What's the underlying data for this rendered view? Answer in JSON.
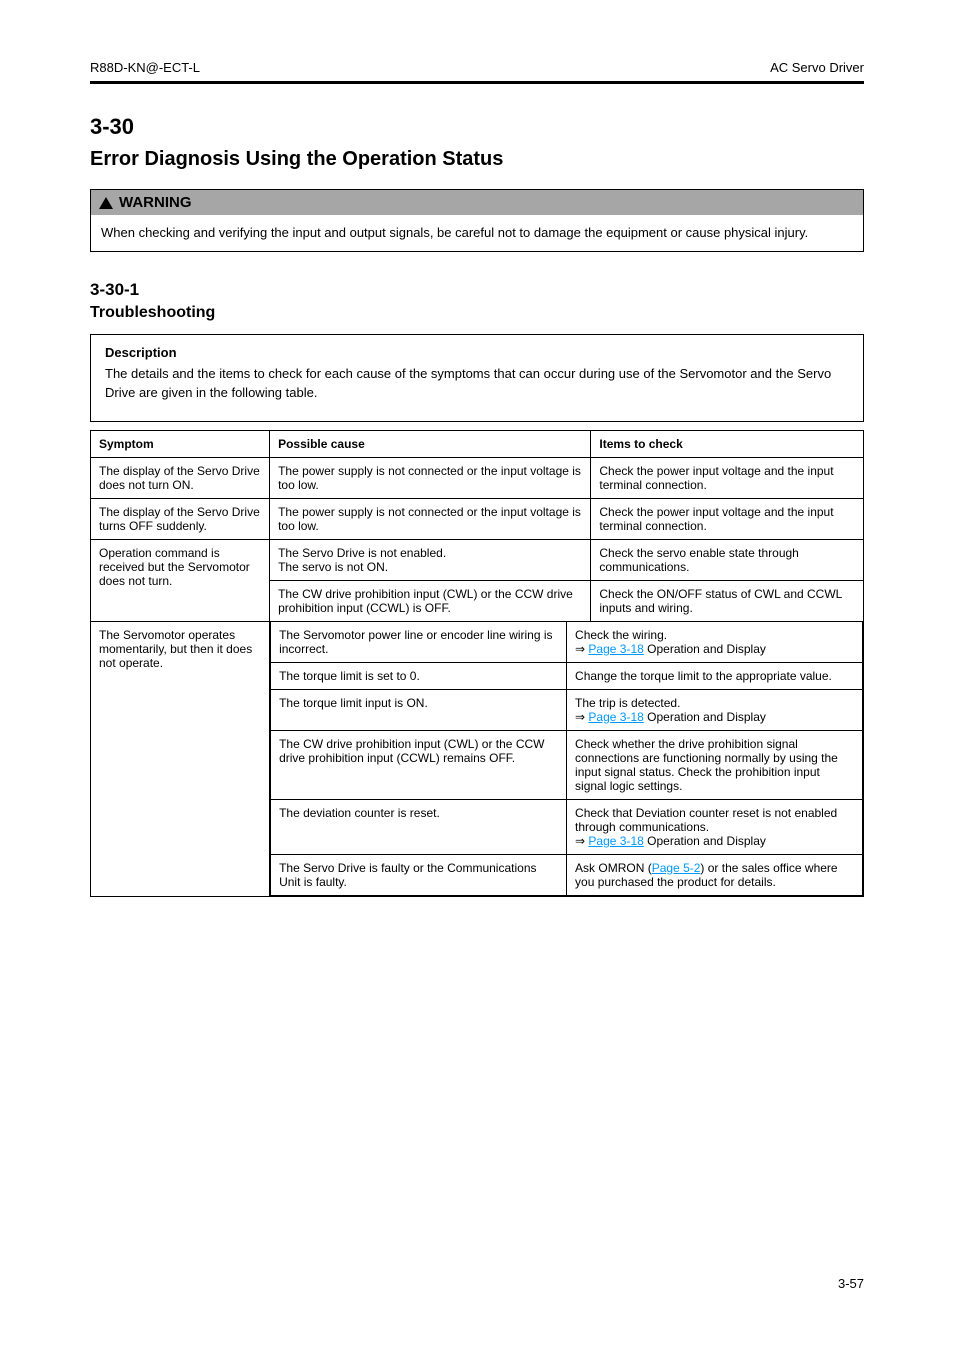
{
  "header": {
    "left": "R88D-KN@-ECT-L",
    "right": "AC Servo Driver"
  },
  "section": {
    "number": "3-30",
    "title": "Error Diagnosis Using the Operation Status"
  },
  "warning": {
    "label": "WARNING",
    "body": "When checking and verifying the input and output signals, be careful not to damage the equipment or cause physical injury."
  },
  "subsection": {
    "number": "3-30-1",
    "title": "Troubleshooting"
  },
  "desc": {
    "label": "Description",
    "text": "The details and the items to check for each cause of the symptoms that can occur during use of the Servomotor and the Servo Drive are given in the following table."
  },
  "table": {
    "columns": [
      "Symptom",
      "Possible cause",
      "Items to check"
    ],
    "rows": [
      {
        "symptom": "The display of the Servo Drive does not turn ON.",
        "cause": "The power supply is not connected or the input voltage is too low.",
        "items": "Check the power input voltage and the input terminal connection."
      },
      {
        "symptom": "The display of the Servo Drive turns OFF suddenly.",
        "cause": "The power supply is not connected or the input voltage is too low.",
        "items": "Check the power input voltage and the input terminal connection."
      },
      {
        "symptom": "Operation command is received but the Servomotor does not turn.",
        "cause": "The Servo Drive is not enabled.\nThe servo is not ON.",
        "items": "Check the servo enable state through communications."
      },
      {
        "symptom": "",
        "cause": "The CW drive prohibition input (CWL) or the CCW drive prohibition input (CCWL) is OFF.",
        "items": "Check the ON/OFF status of CWL and CCWL inputs and wiring."
      },
      {
        "symptom_rowspan": "The Servomotor operates momentarily, but then it does not operate.",
        "sub": [
          {
            "cause": "The Servomotor power line or encoder line wiring is incorrect.",
            "items_plain": "Check the wiring.",
            "items_arrow": "⇒ ",
            "items_link": "Page 3-18",
            "items_tail": " Operation and Display"
          },
          {
            "cause": "The torque limit is set to 0.",
            "items": "Change the torque limit to the appropriate value."
          },
          {
            "cause": "The torque limit input is ON.",
            "items_plain": "The trip is detected.",
            "items_arrow": "⇒ ",
            "items_link": "Page 3-18",
            "items_tail": " Operation and Display"
          },
          {
            "cause": "The CW drive prohibition input (CWL) or the CCW drive prohibition input (CCWL) remains OFF.",
            "items": "Check whether the drive prohibition signal connections are functioning normally by using the input signal status. Check the prohibition input signal logic settings."
          },
          {
            "cause": "The deviation counter is reset.",
            "items_plain": "Check that Deviation counter reset is not enabled through communications.",
            "items_arrow": "⇒ ",
            "items_link": "Page 3-18",
            "items_tail": " Operation and Display"
          },
          {
            "cause": "The Servo Drive is faulty or the Communications Unit is faulty.",
            "items_pre": "Ask OMRON (",
            "items_link": "Page 5-2",
            "items_post": ") or the sales office where you purchased the product for details."
          }
        ]
      }
    ]
  },
  "pageNumber": "3-57"
}
